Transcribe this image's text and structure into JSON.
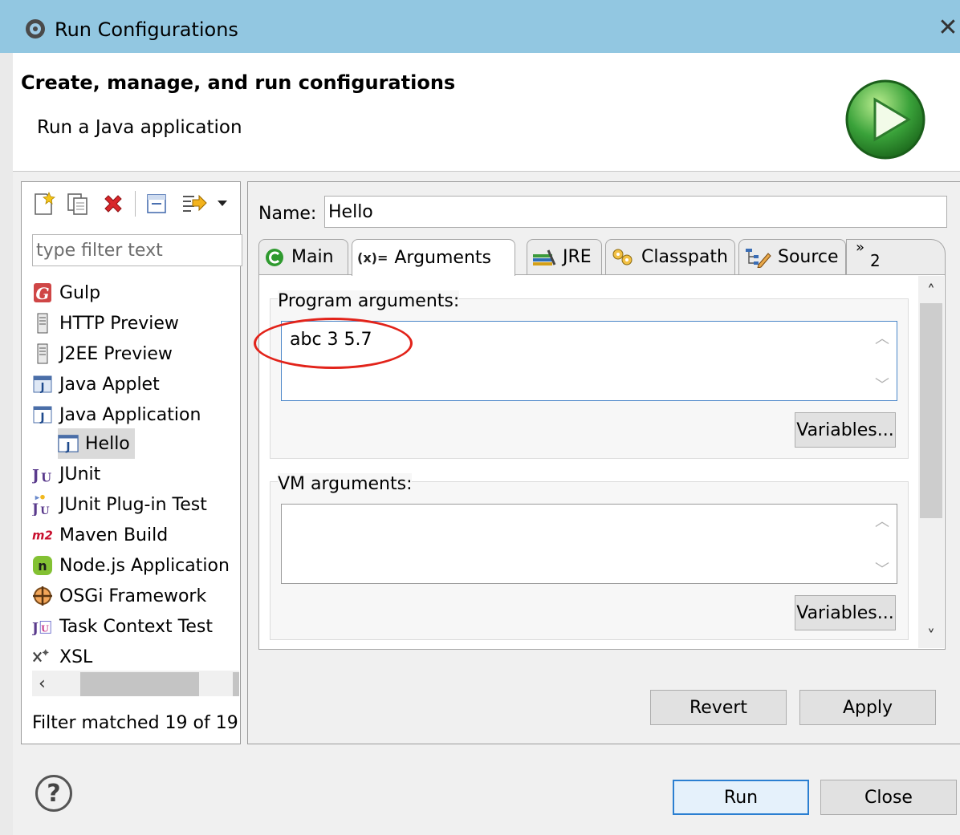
{
  "window": {
    "title": "Run Configurations",
    "close_glyph": "✕"
  },
  "header": {
    "title": "Create, manage, and run configurations",
    "subtitle": "Run a Java application"
  },
  "left": {
    "filter_placeholder": "type filter text",
    "status": "Filter matched 19 of 19",
    "items": [
      {
        "label": "Gulp",
        "icon": "gulp-icon"
      },
      {
        "label": "HTTP Preview",
        "icon": "server-icon"
      },
      {
        "label": "J2EE Preview",
        "icon": "server-icon"
      },
      {
        "label": "Java Applet",
        "icon": "java-applet-icon"
      },
      {
        "label": "Java Application",
        "icon": "java-application-icon"
      },
      {
        "label": "Hello",
        "icon": "java-application-icon"
      },
      {
        "label": "JUnit",
        "icon": "junit-icon"
      },
      {
        "label": "JUnit Plug-in Test",
        "icon": "junit-plugin-icon"
      },
      {
        "label": "Maven Build",
        "icon": "maven-icon"
      },
      {
        "label": "Node.js Application",
        "icon": "nodejs-icon"
      },
      {
        "label": "OSGi Framework",
        "icon": "osgi-icon"
      },
      {
        "label": "Task Context Test",
        "icon": "task-context-icon"
      },
      {
        "label": "XSL",
        "icon": "xsl-icon"
      }
    ]
  },
  "right": {
    "name_label": "Name:",
    "name_value": "Hello",
    "tabs": [
      {
        "label": "Main",
        "icon": "main-tab-icon"
      },
      {
        "label": "Arguments",
        "icon": "arguments-tab-icon",
        "active": true
      },
      {
        "label": "JRE",
        "icon": "jre-tab-icon"
      },
      {
        "label": "Classpath",
        "icon": "classpath-tab-icon"
      },
      {
        "label": "Source",
        "icon": "source-tab-icon"
      }
    ],
    "tab_overflow": {
      "chevron": "»",
      "count": "2"
    },
    "arguments_tab_icon_text": "(x)=",
    "program_arguments_label": "Program arguments:",
    "program_arguments_value": "abc 3 5.7",
    "vm_arguments_label": "VM arguments:",
    "vm_arguments_value": "",
    "variables_label": "Variables...",
    "revert_label": "Revert",
    "apply_label": "Apply"
  },
  "footer": {
    "help_glyph": "?",
    "run_label": "Run",
    "close_label": "Close"
  },
  "colors": {
    "titlebar": "#92c7e1",
    "annotation": "#e2231a",
    "run_logo": "#3aa23a",
    "delete_icon": "#d9262a"
  }
}
